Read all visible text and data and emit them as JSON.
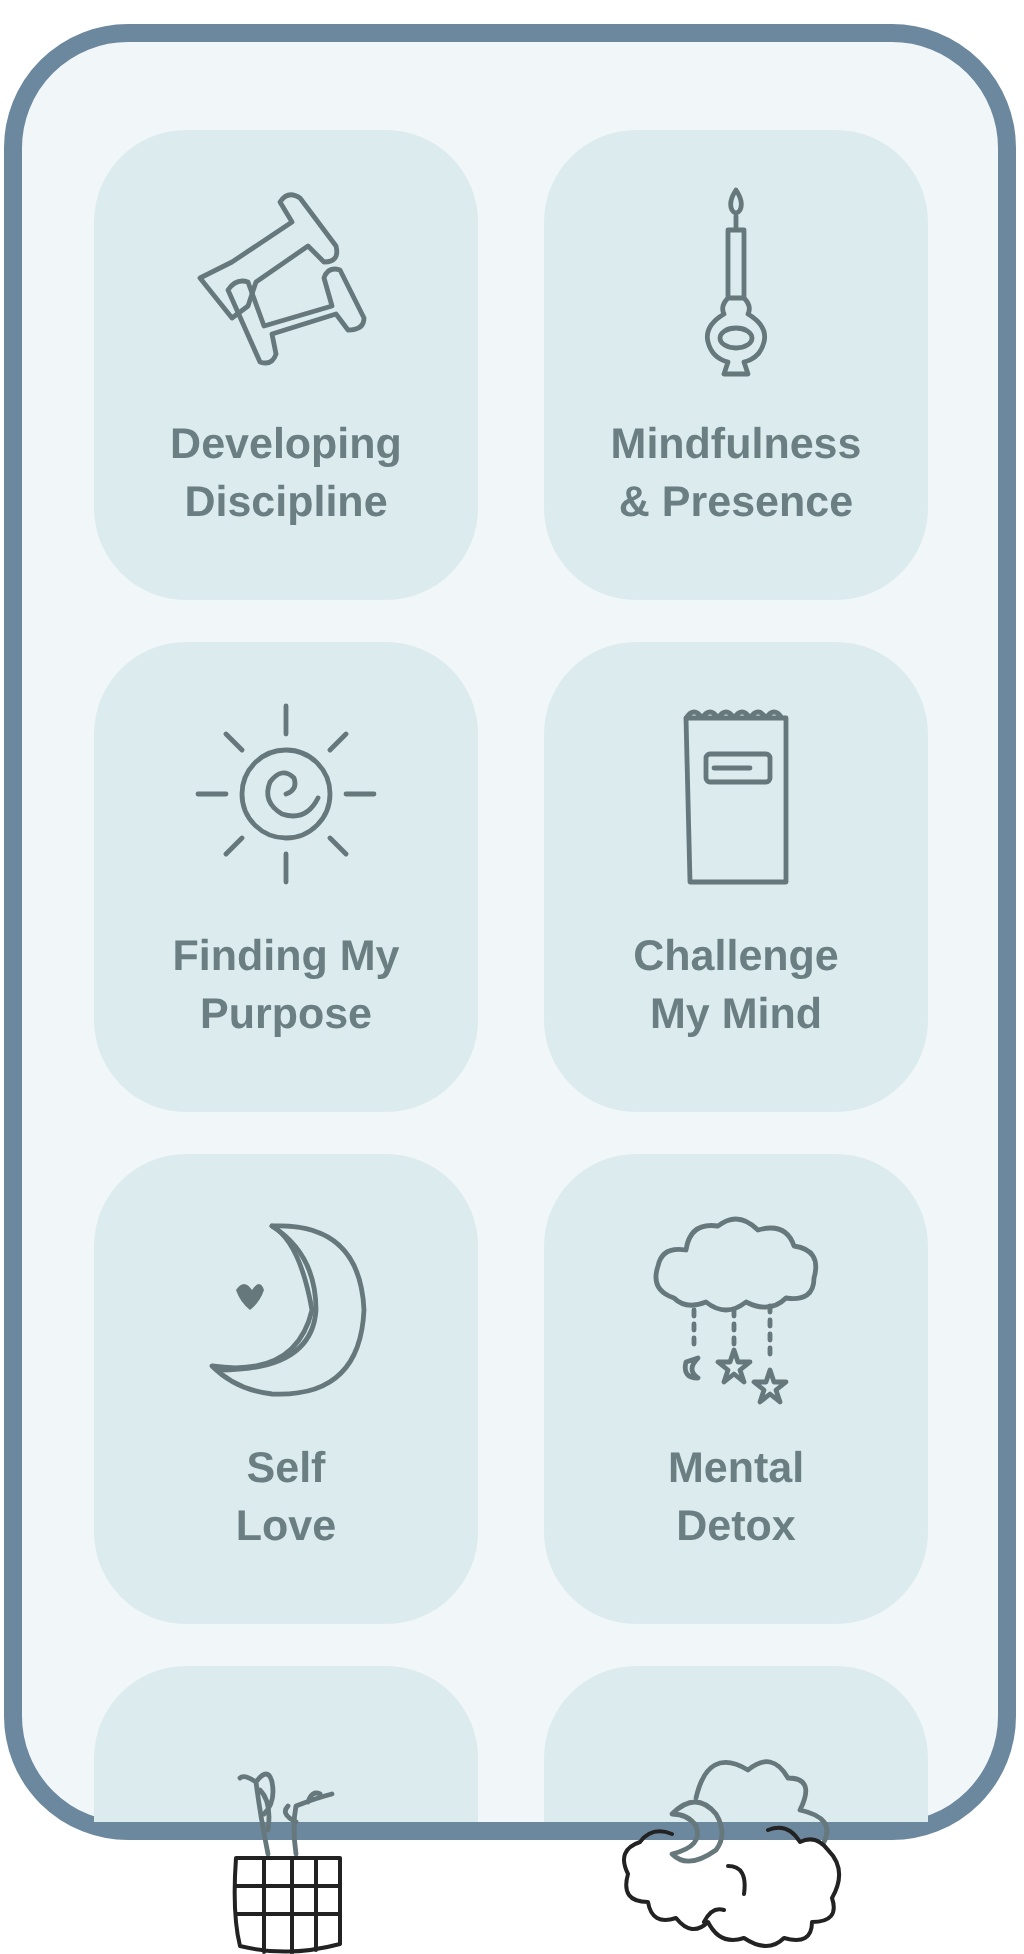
{
  "categories": [
    {
      "kind": "full",
      "label_lines": [
        "Developing",
        "Discipline"
      ]
    },
    {
      "kind": "full",
      "label_lines": [
        "Mindfulness",
        "& Presence"
      ]
    },
    {
      "kind": "full",
      "label_lines": [
        "Finding My",
        "Purpose"
      ]
    },
    {
      "kind": "full",
      "label_lines": [
        "Challenge",
        "My Mind"
      ]
    },
    {
      "kind": "full",
      "label_lines": [
        "Self",
        "Love"
      ]
    },
    {
      "kind": "full",
      "label_lines": [
        "Mental",
        "Detox"
      ]
    },
    {
      "kind": "partial"
    },
    {
      "kind": "partial"
    }
  ]
}
